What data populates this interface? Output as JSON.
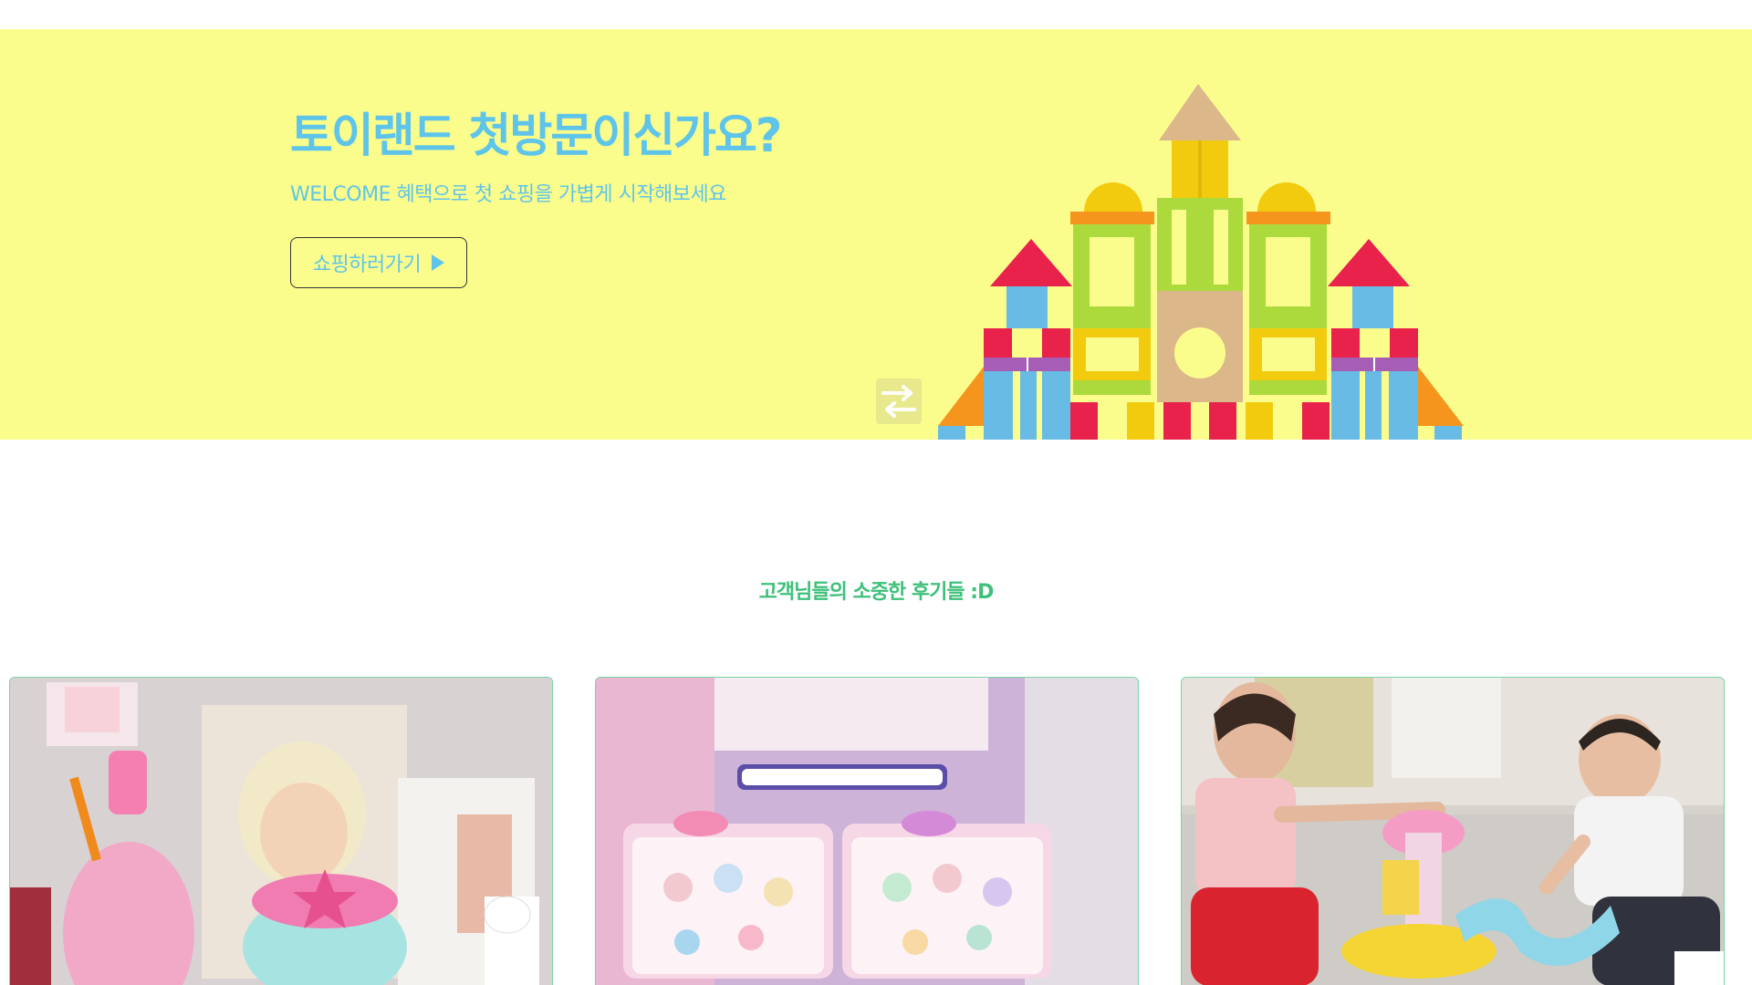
{
  "hero": {
    "title": "토이랜드 첫방문이신가요?",
    "subtitle": "WELCOME 혜택으로 첫 쇼핑을 가볍게 시작해보세요",
    "button_label": "쇼핑하러가기",
    "button_icon": "play-triangle",
    "swap_icon": "swap-arrows-icon",
    "background_color": "#fafd8c",
    "accent_color": "#5fc4ea"
  },
  "reviews": {
    "title": "고객님들의 소중한 후기들 :D",
    "title_color": "#3ec07a",
    "cards": [
      {
        "id": "review-1",
        "image_icon": "toy-photo"
      },
      {
        "id": "review-2",
        "image_icon": "sticker-book-photo"
      },
      {
        "id": "review-3",
        "image_icon": "kids-playing-photo"
      }
    ]
  }
}
